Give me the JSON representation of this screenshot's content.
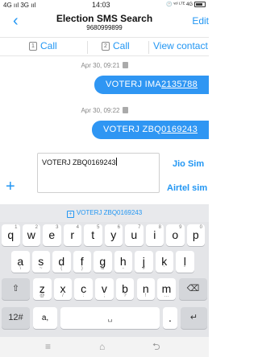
{
  "status_bar": {
    "left": "4G ııl 3G ııl",
    "time": "14:03",
    "right": "🕐 ᵛᵒˡ ᴸᵀᴱ 4G"
  },
  "header": {
    "back_icon": "‹",
    "title": "Election SMS Search",
    "number": "9680999899",
    "edit_label": "Edit"
  },
  "actions": [
    {
      "icon": "1",
      "label": "Call"
    },
    {
      "icon": "2",
      "label": "Call"
    },
    {
      "label": "View contact"
    }
  ],
  "messages": [
    {
      "timestamp": "Apr 30, 09:21",
      "text_plain": "VOTERJ IMA",
      "text_link": "2135788"
    },
    {
      "timestamp": "Apr 30, 09:22",
      "text_plain": "VOTERJ ZBQ",
      "text_link": "0169243"
    }
  ],
  "compose": {
    "value": "VOTERJ ZBQ0169243",
    "plus_icon": "+",
    "sim1_label": "Jio Sim",
    "sim2_label": "Airtel sim"
  },
  "suggestion": {
    "icon": "+",
    "text": "VOTERJ ZBQ0169243"
  },
  "keyboard": {
    "row1": [
      {
        "k": "q",
        "n": "1"
      },
      {
        "k": "w",
        "n": "2"
      },
      {
        "k": "e",
        "n": "3"
      },
      {
        "k": "r",
        "n": "4"
      },
      {
        "k": "t",
        "n": "5"
      },
      {
        "k": "y",
        "n": "6"
      },
      {
        "k": "u",
        "n": "7"
      },
      {
        "k": "i",
        "n": "8"
      },
      {
        "k": "o",
        "n": "9"
      },
      {
        "k": "p",
        "n": "0"
      }
    ],
    "row2": [
      {
        "k": "a",
        "n": "\\"
      },
      {
        "k": "s",
        "n": "~"
      },
      {
        "k": "d",
        "n": "("
      },
      {
        "k": "f",
        "n": ")"
      },
      {
        "k": "g",
        "n": "&"
      },
      {
        "k": "h",
        "n": "-"
      },
      {
        "k": "j",
        "n": "#"
      },
      {
        "k": "k",
        "n": "'"
      },
      {
        "k": "l",
        "n": "\""
      }
    ],
    "row3": [
      {
        "k": "z",
        "n": "@"
      },
      {
        "k": "x",
        "n": "/"
      },
      {
        "k": "c",
        "n": ":"
      },
      {
        "k": "v",
        "n": ";"
      },
      {
        "k": "b",
        "n": "?"
      },
      {
        "k": "n",
        "n": "!"
      },
      {
        "k": "m",
        "n": "…"
      }
    ],
    "shift_icon": "⇧",
    "backspace_icon": "⌫",
    "numsym_label": "12#",
    "comma_label": "a,",
    "space_label": "␣",
    "period_label": ".",
    "enter_icon": "↵"
  },
  "nav": {
    "menu_icon": "≡",
    "home_icon": "⌂",
    "back_icon": "⮌"
  },
  "colors": {
    "accent": "#2196f3",
    "bubble": "#2f96f3"
  }
}
